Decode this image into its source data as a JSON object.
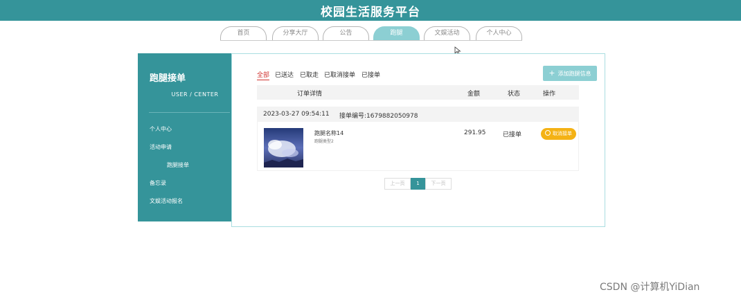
{
  "header": {
    "title": "校园生活服务平台",
    "bg_color": "#35949a"
  },
  "nav": {
    "tabs": [
      {
        "label": "首页",
        "active": false
      },
      {
        "label": "分享大厅",
        "active": false
      },
      {
        "label": "公告",
        "active": false
      },
      {
        "label": "跑腿",
        "active": true
      },
      {
        "label": "文娱活动",
        "active": false
      },
      {
        "label": "个人中心",
        "active": false
      }
    ]
  },
  "sidebar": {
    "title": "跑腿接单",
    "subtitle": "USER / CENTER",
    "items": [
      {
        "label": "个人中心"
      },
      {
        "label": "活动申请"
      },
      {
        "label": "跑腿接单"
      },
      {
        "label": "备忘录"
      },
      {
        "label": "文娱活动报名"
      }
    ]
  },
  "main": {
    "filters": [
      {
        "label": "全部",
        "active": true
      },
      {
        "label": "已送达",
        "active": false
      },
      {
        "label": "已取走",
        "active": false
      },
      {
        "label": "已取消接单",
        "active": false
      },
      {
        "label": "已接单",
        "active": false
      }
    ],
    "add_button": "添加跑腿信息",
    "table_headers": {
      "detail": "订单详情",
      "amount": "金额",
      "status": "状态",
      "action": "操作"
    },
    "order": {
      "date": "2023-03-27 09:54:11",
      "order_no": "接单编号:1679882050978",
      "item_name": "跑腿名称14",
      "item_sub": "跑腿类型2",
      "amount": "291.95",
      "status": "已接单",
      "action_label": "取消接单"
    },
    "pagination": {
      "prev": "上一页",
      "current": "1",
      "next": "下一页"
    }
  },
  "watermark": "CSDN @计算机YiDian",
  "colors": {
    "accent": "#35949a",
    "tab_active": "#8ccfd3",
    "button_orange": "#f4b215",
    "filter_active": "#d0332f"
  }
}
